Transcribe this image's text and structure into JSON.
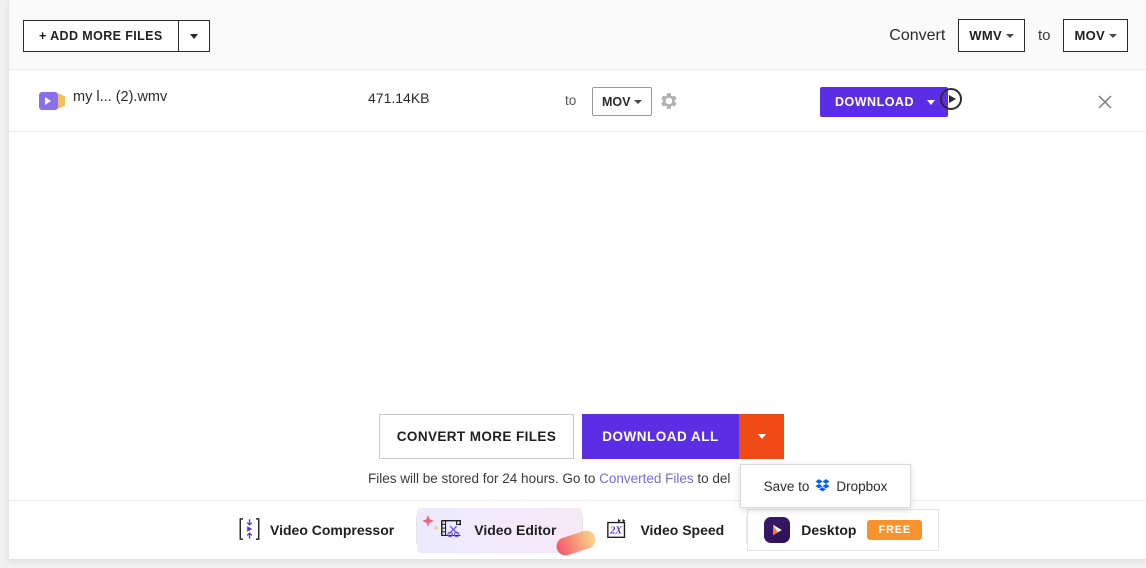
{
  "header": {
    "add_more_files_label": "+ ADD MORE FILES",
    "convert_label": "Convert",
    "source_format": "WMV",
    "to_label": "to",
    "target_format": "MOV"
  },
  "file_row": {
    "name": "my l... (2).wmv",
    "size": "471.14KB",
    "to_label": "to",
    "format": "MOV",
    "download_label": "DOWNLOAD"
  },
  "actions": {
    "convert_more_label": "CONVERT MORE FILES",
    "download_all_label": "DOWNLOAD ALL"
  },
  "dropdown": {
    "save_to_dropbox_label": "Save to",
    "dropbox_name": "Dropbox"
  },
  "note": {
    "prefix": "Files will be stored for 24 hours. Go to ",
    "link": "Converted Files",
    "suffix": " to del"
  },
  "bottombar": {
    "tools": [
      {
        "label": "Video Compressor"
      },
      {
        "label": "Video Editor"
      },
      {
        "label": "Video Speed"
      },
      {
        "label": "Desktop",
        "badge": "FREE"
      }
    ]
  },
  "colors": {
    "accent_purple": "#5b2ee5",
    "accent_orange": "#f04a16",
    "badge_orange": "#f7922e",
    "link_purple": "#7a6ad8",
    "dropbox_blue": "#0061fe"
  }
}
